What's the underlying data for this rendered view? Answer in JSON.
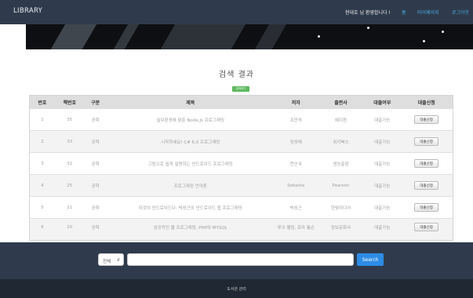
{
  "nav": {
    "brand": "LIBRARY",
    "welcome": "현대호 님 환영합니다 !",
    "links": [
      "홈",
      "마이페이지",
      "로그아웃"
    ]
  },
  "main": {
    "title": "검색 결과",
    "badge": "검색하기"
  },
  "table": {
    "headers": [
      "번호",
      "책번호",
      "구분",
      "제목",
      "저자",
      "출판사",
      "대출여부",
      "대출신청"
    ],
    "rows": [
      [
        "1",
        "35",
        "공학",
        "실무환경에 맞춘 Node.Js 프로그래밍",
        "조민석",
        "혜지원",
        "대출가능",
        "대출신청"
      ],
      [
        "2",
        "33",
        "공학",
        "시작하세요! C# 6.0 프로그래밍",
        "정성태",
        "위키북스",
        "대출가능",
        "대출신청"
      ],
      [
        "3",
        "32",
        "공학",
        "그림으로 쉽게 설명하는 안드로이드 프로그래밍",
        "천인국",
        "생능출판",
        "대출가능",
        "대출신청"
      ],
      [
        "4",
        "25",
        "공학",
        "프로그래밍 언어론",
        "Sebesta",
        "Pearson",
        "대출가능",
        "대출신청"
      ],
      [
        "5",
        "21",
        "공학",
        "이것이 안드로이드다: 박성근의 안드로이드 앱 프로그래밍",
        "박성근",
        "한빛미디어",
        "대출가능",
        "대출신청"
      ],
      [
        "6",
        "20",
        "공학",
        "성공적인 웹 프로그래밍, PHP와 MYSQL",
        "루크 웰링, 로라 톰슨",
        "정보문화사",
        "대출가능",
        "대출신청"
      ]
    ]
  },
  "search": {
    "select_value": "전체",
    "input_value": "",
    "button_label": "Search"
  },
  "footer": {
    "text": "도서관 관리"
  },
  "colors": {
    "nav_bg": "#2f3b4c",
    "link": "#4aa8e0",
    "search_btn": "#2d8ce6",
    "badge": "#5cb85c"
  }
}
